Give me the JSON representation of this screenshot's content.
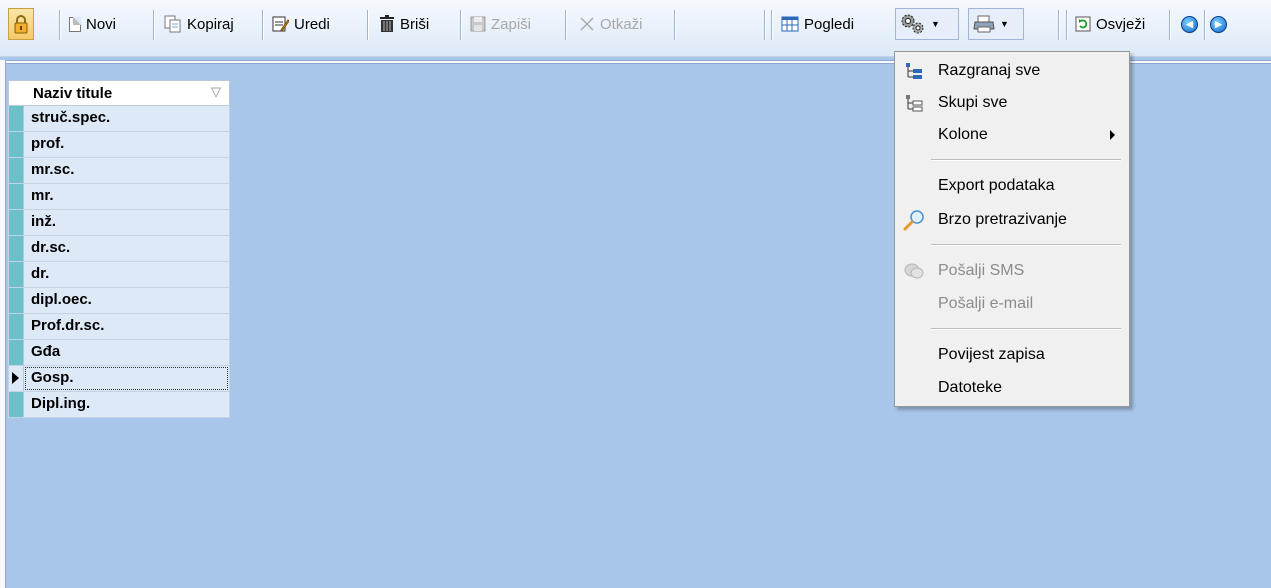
{
  "toolbar": {
    "novi": "Novi",
    "kopiraj": "Kopiraj",
    "uredi": "Uredi",
    "brisi": "Briši",
    "zapisi": "Zapiši",
    "otkazi": "Otkaži",
    "pogledi": "Pogledi",
    "osvjezi": "Osvježi"
  },
  "grid": {
    "header": "Naziv titule",
    "rows": [
      "struč.spec.",
      "prof.",
      "mr.sc.",
      "mr.",
      "inž.",
      "dr.sc.",
      "dr.",
      "dipl.oec.",
      "Prof.dr.sc.",
      "Gđa",
      "Gosp.",
      "Dipl.ing."
    ],
    "current_row": "Gosp."
  },
  "menu": {
    "items": [
      {
        "label": "Razgranaj sve",
        "icon": "expand-tree-icon",
        "enabled": true
      },
      {
        "label": "Skupi sve",
        "icon": "collapse-tree-icon",
        "enabled": true
      },
      {
        "label": "Kolone",
        "icon": "",
        "enabled": true,
        "submenu": true
      },
      {
        "label": "Export podataka",
        "icon": "",
        "enabled": true
      },
      {
        "label": "Brzo pretrazivanje",
        "icon": "magnifier-icon",
        "enabled": true
      },
      {
        "label": "Pošalji SMS",
        "icon": "sms-icon",
        "enabled": false
      },
      {
        "label": "Pošalji e-mail",
        "icon": "",
        "enabled": false
      },
      {
        "label": "Povijest zapisa",
        "icon": "",
        "enabled": true
      },
      {
        "label": "Datoteke",
        "icon": "",
        "enabled": true
      }
    ]
  },
  "colors": {
    "workspace": "#a8c6ea",
    "row_background": "#dde9f7",
    "row_indicator": "#6cc0c7",
    "menu_background": "#f0f0f0"
  }
}
